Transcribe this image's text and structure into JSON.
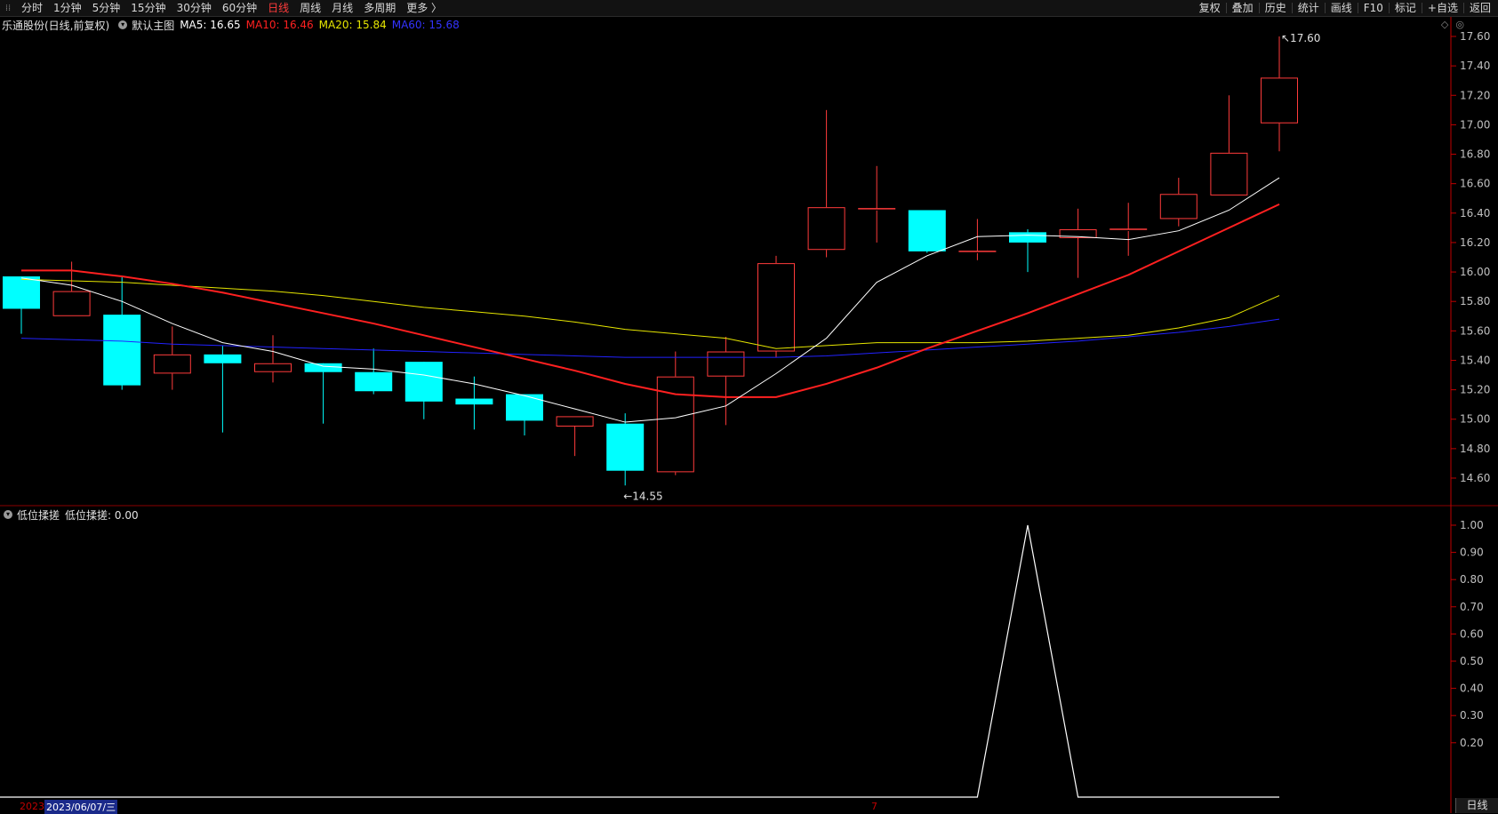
{
  "toolbar": {
    "periods": [
      "分时",
      "1分钟",
      "5分钟",
      "15分钟",
      "30分钟",
      "60分钟",
      "日线",
      "周线",
      "月线",
      "多周期",
      "更多 〉"
    ],
    "active_period": "日线",
    "tools": [
      "复权",
      "叠加",
      "历史",
      "统计",
      "画线",
      "F10",
      "标记",
      "+自选",
      "返回"
    ]
  },
  "main_info": {
    "stock": "乐通股份(日线,前复权)",
    "template": "默认主图",
    "ma5": "MA5: 16.65",
    "ma10": "MA10: 16.46",
    "ma20": "MA20: 15.84",
    "ma60": "MA60: 15.68"
  },
  "sub_info": {
    "indicator": "低位揉搓",
    "value": "低位揉搓: 0.00"
  },
  "bottom": {
    "year_label": "2023",
    "date_cursor": "2023/06/07/三",
    "mid_marker": "7",
    "period_tab": "日线"
  },
  "colors": {
    "up": "#ff3b3b",
    "down": "#00ffff",
    "ma5": "#ffffff",
    "ma10": "#ff2020",
    "ma20": "#e6e600",
    "ma60": "#2222ff",
    "axis": "#c00000",
    "indicator": "#ffffff"
  },
  "chart_data": {
    "type": "candlestick",
    "price_axis": {
      "min": 14.5,
      "max": 17.7,
      "ticks": [
        "17.60",
        "17.40",
        "17.20",
        "17.00",
        "16.80",
        "16.60",
        "16.40",
        "16.20",
        "16.00",
        "15.80",
        "15.60",
        "15.40",
        "15.20",
        "15.00",
        "14.80",
        "14.60"
      ]
    },
    "annotations": {
      "high_label": "17.60",
      "low_label": "14.55"
    },
    "candles": [
      {
        "o": 15.97,
        "h": 15.97,
        "l": 15.58,
        "c": 15.75
      },
      {
        "o": 15.7,
        "h": 16.07,
        "l": 15.7,
        "c": 15.87
      },
      {
        "o": 15.71,
        "h": 15.97,
        "l": 15.2,
        "c": 15.23
      },
      {
        "o": 15.31,
        "h": 15.63,
        "l": 15.2,
        "c": 15.44
      },
      {
        "o": 15.44,
        "h": 15.5,
        "l": 14.91,
        "c": 15.38
      },
      {
        "o": 15.32,
        "h": 15.57,
        "l": 15.25,
        "c": 15.38
      },
      {
        "o": 15.38,
        "h": 15.38,
        "l": 14.97,
        "c": 15.32
      },
      {
        "o": 15.32,
        "h": 15.48,
        "l": 15.17,
        "c": 15.19
      },
      {
        "o": 15.39,
        "h": 15.39,
        "l": 15.0,
        "c": 15.12
      },
      {
        "o": 15.14,
        "h": 15.29,
        "l": 14.93,
        "c": 15.1
      },
      {
        "o": 15.17,
        "h": 15.17,
        "l": 14.89,
        "c": 14.99
      },
      {
        "o": 14.95,
        "h": 15.02,
        "l": 14.75,
        "c": 15.02
      },
      {
        "o": 14.97,
        "h": 15.04,
        "l": 14.55,
        "c": 14.65
      },
      {
        "o": 14.64,
        "h": 15.46,
        "l": 14.62,
        "c": 15.29
      },
      {
        "o": 15.29,
        "h": 15.56,
        "l": 14.96,
        "c": 15.46
      },
      {
        "o": 15.46,
        "h": 16.11,
        "l": 15.42,
        "c": 16.06
      },
      {
        "o": 16.15,
        "h": 17.1,
        "l": 16.1,
        "c": 16.44
      },
      {
        "o": 16.43,
        "h": 16.72,
        "l": 16.2,
        "c": 16.43
      },
      {
        "o": 16.42,
        "h": 16.42,
        "l": 16.13,
        "c": 16.14
      },
      {
        "o": 16.14,
        "h": 16.36,
        "l": 16.08,
        "c": 16.14
      },
      {
        "o": 16.27,
        "h": 16.29,
        "l": 16.0,
        "c": 16.2
      },
      {
        "o": 16.23,
        "h": 16.43,
        "l": 15.96,
        "c": 16.29
      },
      {
        "o": 16.29,
        "h": 16.47,
        "l": 16.11,
        "c": 16.29
      },
      {
        "o": 16.36,
        "h": 16.64,
        "l": 16.31,
        "c": 16.53
      },
      {
        "o": 16.52,
        "h": 17.2,
        "l": 16.52,
        "c": 16.81
      },
      {
        "o": 17.01,
        "h": 17.6,
        "l": 16.82,
        "c": 17.32
      }
    ],
    "ma5": [
      15.96,
      15.91,
      15.8,
      15.65,
      15.52,
      15.46,
      15.36,
      15.34,
      15.3,
      15.24,
      15.16,
      15.07,
      14.98,
      15.01,
      15.09,
      15.31,
      15.55,
      15.93,
      16.11,
      16.24,
      16.25,
      16.24,
      16.22,
      16.28,
      16.42,
      16.64
    ],
    "ma10": [
      16.01,
      16.01,
      15.97,
      15.92,
      15.86,
      15.79,
      15.72,
      15.65,
      15.57,
      15.49,
      15.41,
      15.33,
      15.24,
      15.17,
      15.15,
      15.15,
      15.24,
      15.35,
      15.48,
      15.6,
      15.72,
      15.85,
      15.98,
      16.14,
      16.3,
      16.46
    ],
    "ma20": [
      15.95,
      15.94,
      15.93,
      15.91,
      15.89,
      15.87,
      15.84,
      15.8,
      15.76,
      15.73,
      15.7,
      15.66,
      15.61,
      15.58,
      15.55,
      15.48,
      15.5,
      15.52,
      15.52,
      15.52,
      15.53,
      15.55,
      15.57,
      15.62,
      15.69,
      15.84
    ],
    "ma60": [
      15.55,
      15.54,
      15.53,
      15.51,
      15.5,
      15.49,
      15.48,
      15.47,
      15.46,
      15.45,
      15.44,
      15.43,
      15.42,
      15.42,
      15.42,
      15.42,
      15.43,
      15.45,
      15.47,
      15.49,
      15.51,
      15.53,
      15.56,
      15.59,
      15.63,
      15.68
    ],
    "indicator": {
      "name": "低位揉搓",
      "values": [
        0,
        0,
        0,
        0,
        0,
        0,
        0,
        0,
        0,
        0,
        0,
        0,
        0,
        0,
        0,
        0,
        0,
        0,
        0,
        0,
        1,
        0,
        0,
        0,
        0,
        0
      ],
      "ticks": [
        "1.00",
        "0.90",
        "0.80",
        "0.70",
        "0.60",
        "0.50",
        "0.40",
        "0.30",
        "0.20"
      ],
      "min": 0,
      "max": 1.0
    }
  }
}
